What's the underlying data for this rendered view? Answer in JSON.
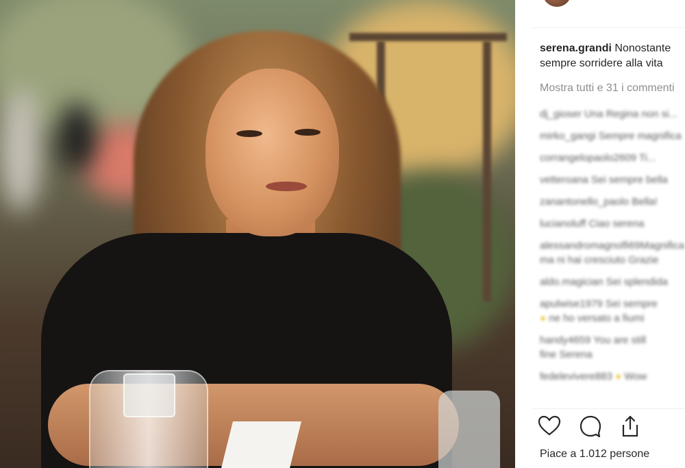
{
  "post": {
    "username": "serena.grandi",
    "caption_line1": "Nonostante",
    "caption_line2": "sempre sorridere alla vita",
    "show_all_comments": "Mostra tutti e 31 i commenti",
    "likes_text": "Piace a 1.012 persone"
  },
  "comments": [
    {
      "text": "dj_gioser Una Regina non si..."
    },
    {
      "text": "mirko_gangi Sempre magnifica"
    },
    {
      "text": "corrangelopaolo2609 Ti..."
    },
    {
      "text": "vetteroana Sei sempre bella"
    },
    {
      "text": "zanantonello_paolo Bella!"
    },
    {
      "text": "lucianoluff Ciao serena"
    },
    {
      "text": "alessandromagnolfi69Magnifica",
      "line2": "ma ni hai cresciuto Grazie"
    },
    {
      "text": "aldo.magician Sei splendida"
    },
    {
      "text": "apulwise1979 Sei sempre",
      "emoji": "●",
      "line2": "ne ho versato a fiumi"
    },
    {
      "text": "handy4659 You are still",
      "line2": "fine Serena"
    },
    {
      "text": "fedelevivere883",
      "emoji": "●",
      "line2_inline": "Wow"
    }
  ],
  "icons": {
    "like": "heart-icon",
    "comment": "comment-icon",
    "share": "share-icon"
  },
  "colors": {
    "text": "#262626",
    "muted": "#8e8e8e",
    "divider": "#efefef"
  }
}
